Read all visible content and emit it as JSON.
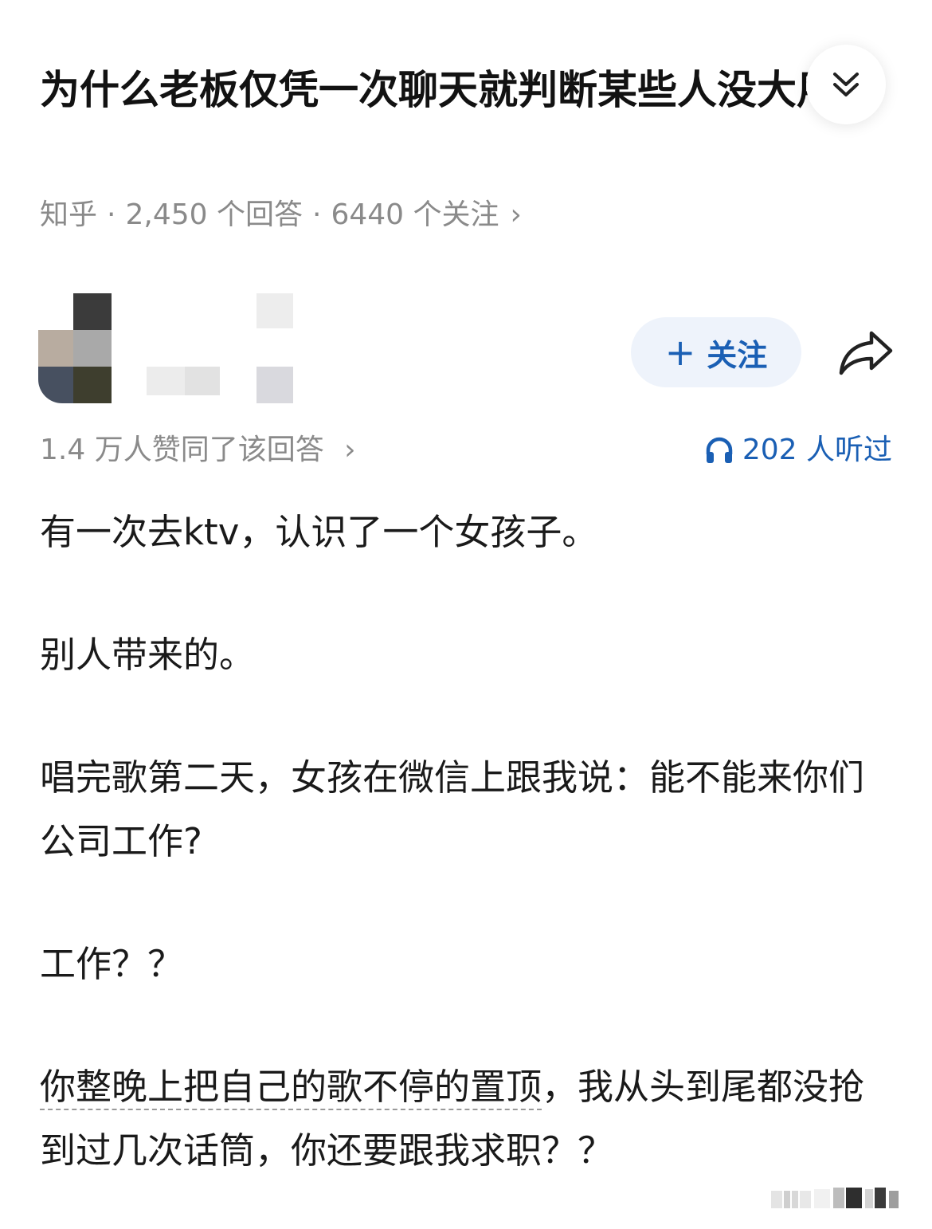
{
  "question": {
    "title": "为什么老板仅凭一次聊天就判断某些人没大用?",
    "meta": {
      "source": "知乎",
      "sep": "·",
      "answers": "2,450 个回答",
      "followers": "6440 个关注",
      "chevron": "›"
    }
  },
  "author": {
    "follow_label": "关注",
    "follow_plus": "+"
  },
  "stats": {
    "likes": "1.4 万人赞同了该回答",
    "likes_chevron": "›",
    "listens": "202 人听过"
  },
  "answer": {
    "p1": "有一次去ktv，认识了一个女孩子。",
    "p2": "别人带来的。",
    "p3": "唱完歌第二天，女孩在微信上跟我说：能不能来你们公司工作?",
    "p4": "工作？？",
    "p5_underlined": "你整晚上把自己的歌不停的置顶",
    "p5_rest": "，我从头到尾都没抢到过几次话筒，你还要跟我求职？？"
  },
  "colors": {
    "accent": "#1a5fb4",
    "meta_gray": "#8a8a8a",
    "follow_bg": "#eef3fb"
  },
  "icons": {
    "collapse": "double-chevron-down-icon",
    "share": "share-arrow-icon",
    "listen": "headphones-icon"
  }
}
